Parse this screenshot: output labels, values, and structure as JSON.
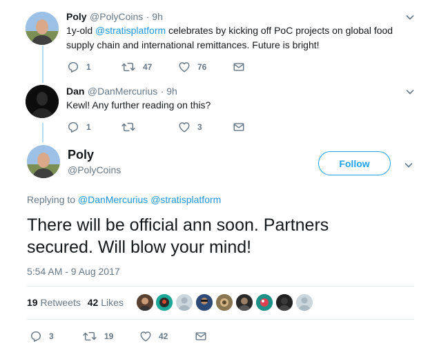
{
  "tweet1": {
    "name": "Poly",
    "handle": "@PolyCoins",
    "time": "· 9h",
    "text_prefix": "1y-old ",
    "mention": "@stratisplatform",
    "text_suffix": " celebrates by kicking off PoC projects on global food",
    "text_line2": "supply chain and international remittances. Future is bright!",
    "replies": "1",
    "retweets": "47",
    "likes": "76"
  },
  "tweet2": {
    "name": "Dan",
    "handle": "@DanMercurius",
    "time": "· 9h",
    "text": "Kewl! Any further reading on this?",
    "replies": "1",
    "retweets": "",
    "likes": "3"
  },
  "main": {
    "name": "Poly",
    "handle": "@PolyCoins",
    "follow_label": "Follow",
    "replying_to_label": "Replying to ",
    "replying_to_1": "@DanMercurius",
    "replying_to_2": "@stratisplatform",
    "text_line1": "There will be official ann soon. Partners",
    "text_line2": "secured. Will blow your mind!",
    "timestamp": "5:54 AM - 9 Aug 2017",
    "retweet_count": "19",
    "retweet_label": "Retweets",
    "like_count": "42",
    "like_label": "Likes",
    "replies": "3",
    "retweets": "19",
    "likes": "42"
  },
  "colors": {
    "accent": "#1da1f2",
    "link": "#1b95e0",
    "muted": "#657786",
    "thread_line": "#b9dcf3"
  },
  "icons": [
    "reply-icon",
    "retweet-icon",
    "like-icon",
    "message-icon",
    "chevron-down-icon"
  ]
}
